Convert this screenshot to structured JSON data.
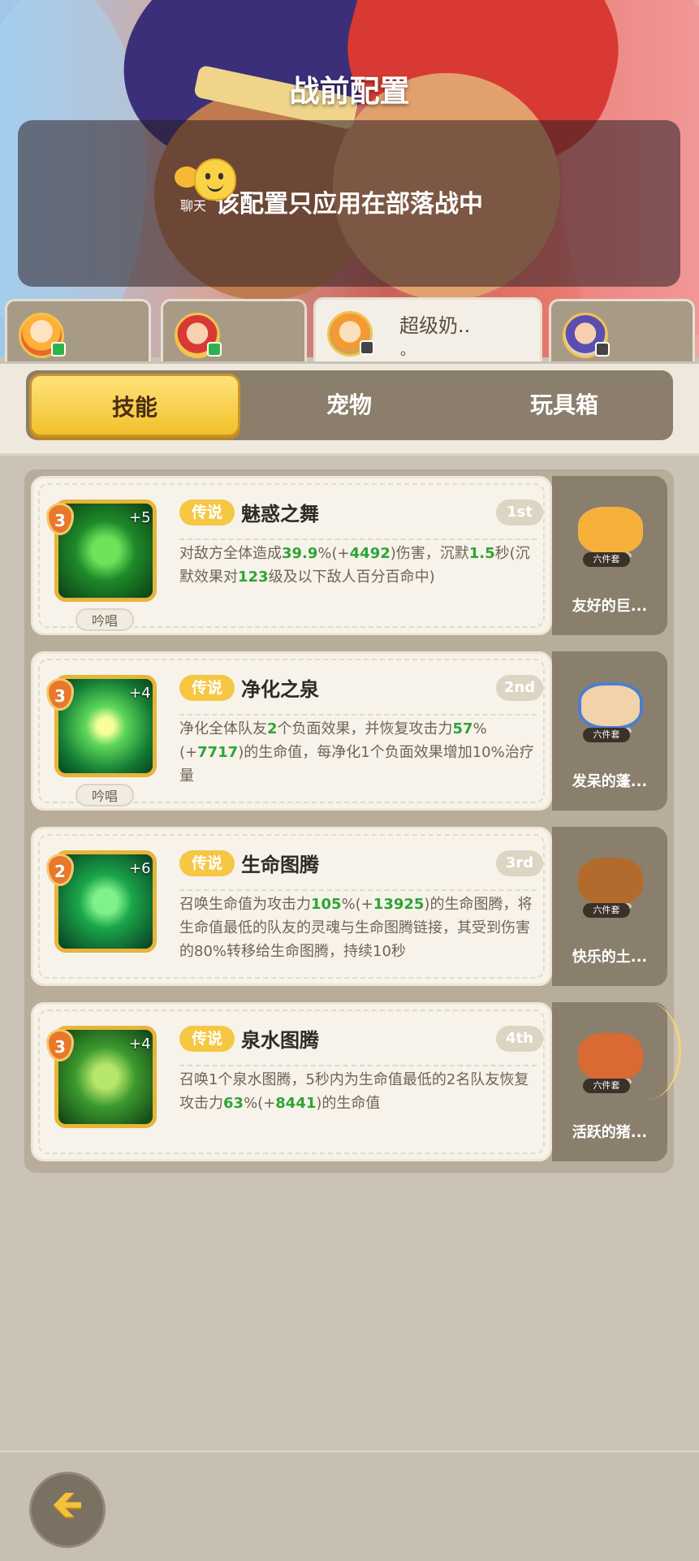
{
  "header": {
    "title": "战前配置",
    "notice": "该配置只应用在部落战中",
    "chat_label": "聊天"
  },
  "team_tabs": [
    {
      "name": "",
      "status": "online"
    },
    {
      "name": "",
      "status": "online"
    },
    {
      "name": "超级奶..",
      "sub": "。",
      "status": "offline",
      "active": true
    },
    {
      "name": "",
      "status": "offline"
    }
  ],
  "segments": {
    "skills": "技能",
    "pets": "宠物",
    "toybox": "玩具箱"
  },
  "skills": [
    {
      "level": "3",
      "plus": "+5",
      "cast": "吟唱",
      "rarity": "传说",
      "name": "魅惑之舞",
      "rank": "1st",
      "desc": [
        {
          "t": "对敌方全体造成"
        },
        {
          "t": "39.9",
          "g": true
        },
        {
          "t": "%(+"
        },
        {
          "t": "4492",
          "g": true
        },
        {
          "t": ")伤害，沉默"
        },
        {
          "t": "1.5",
          "g": true
        },
        {
          "t": "秒(沉默效果对"
        },
        {
          "t": "123",
          "g": true
        },
        {
          "t": "级及以下敌人百分百命中)"
        }
      ],
      "pet_name": "友好的巨...",
      "pet_tag": "六件套"
    },
    {
      "level": "3",
      "plus": "+4",
      "cast": "吟唱",
      "rarity": "传说",
      "name": "净化之泉",
      "rank": "2nd",
      "desc": [
        {
          "t": "净化全体队友"
        },
        {
          "t": "2",
          "g": true
        },
        {
          "t": "个负面效果，并恢复攻击力"
        },
        {
          "t": "57",
          "g": true
        },
        {
          "t": "%(+"
        },
        {
          "t": "7717",
          "g": true
        },
        {
          "t": ")的生命值，每净化1个负面效果增加10%治疗量"
        }
      ],
      "pet_name": "发呆的蓬...",
      "pet_tag": "六件套"
    },
    {
      "level": "2",
      "plus": "+6",
      "cast": "",
      "rarity": "传说",
      "name": "生命图腾",
      "rank": "3rd",
      "desc": [
        {
          "t": "召唤生命值为攻击力"
        },
        {
          "t": "105",
          "g": true
        },
        {
          "t": "%(+"
        },
        {
          "t": "13925",
          "g": true
        },
        {
          "t": ")的生命图腾，将生命值最低的队友的灵魂与生命图腾链接，其受到伤害的80%转移给生命图腾，持续10秒"
        }
      ],
      "pet_name": "快乐的土...",
      "pet_tag": "六件套"
    },
    {
      "level": "3",
      "plus": "+4",
      "cast": "",
      "rarity": "传说",
      "name": "泉水图腾",
      "rank": "4th",
      "desc": [
        {
          "t": "召唤1个泉水图腾，5秒内为生命值最低的2名队友恢复攻击力"
        },
        {
          "t": "63",
          "g": true
        },
        {
          "t": "%(+"
        },
        {
          "t": "8441",
          "g": true
        },
        {
          "t": ")的生命值"
        }
      ],
      "pet_name": "活跃的猪...",
      "pet_tag": "六件套"
    }
  ],
  "footer": {
    "back_icon": "back-arrow-icon"
  }
}
